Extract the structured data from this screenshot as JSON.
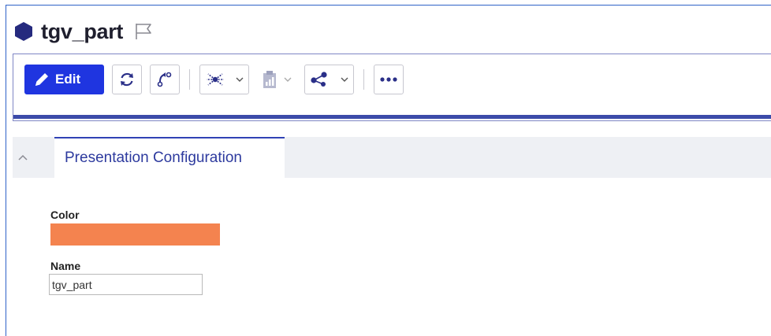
{
  "window": {
    "title": "tgv_part",
    "icon": "hexagon-icon",
    "flag_icon": "flag-icon"
  },
  "toolbar": {
    "edit_label": "Edit",
    "buttons": [
      {
        "icon": "pencil-icon",
        "label": "Edit"
      },
      {
        "icon": "refresh-icon"
      },
      {
        "icon": "path-icon"
      },
      {
        "icon": "network-icon",
        "dropdown": true
      },
      {
        "icon": "clipboard-chart-icon",
        "dropdown": true,
        "disabled": true
      },
      {
        "icon": "share-icon",
        "dropdown": true
      },
      {
        "icon": "more-icon"
      }
    ]
  },
  "panel": {
    "collapse_icon": "chevron-up-icon",
    "tab_label": "Presentation Configuration"
  },
  "form": {
    "color_label": "Color",
    "color_value": "#f4834f",
    "name_label": "Name",
    "name_value": "tgv_part"
  },
  "colors": {
    "accent": "#1f35e0",
    "accent_dark": "#3c4ba9",
    "tab_text": "#2d3a9e"
  }
}
